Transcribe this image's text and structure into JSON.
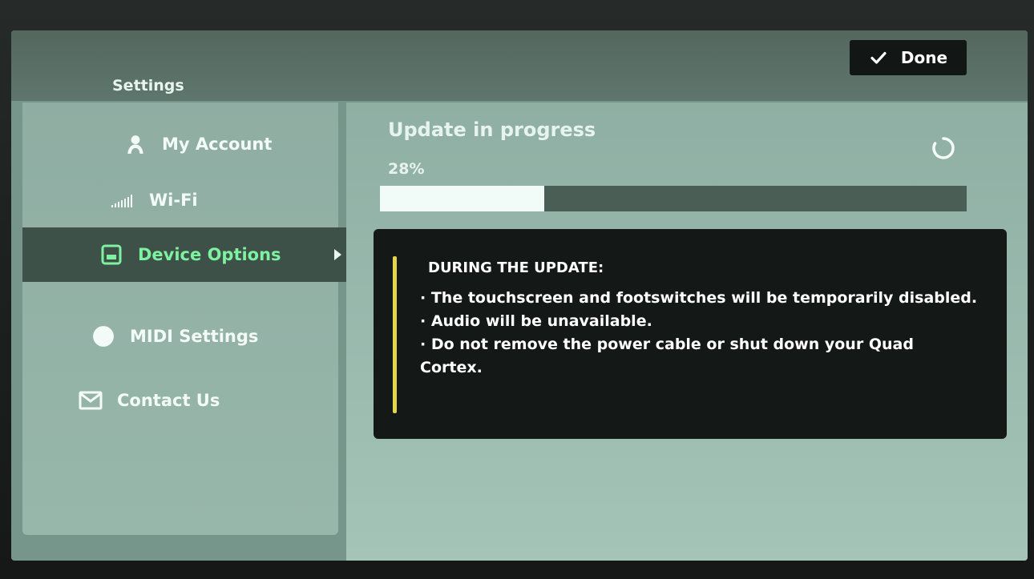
{
  "settings": {
    "title": "Settings",
    "done_label": "Done"
  },
  "sidebar": {
    "items": [
      {
        "label": "My Account",
        "icon": "account-icon"
      },
      {
        "label": "Wi-Fi",
        "icon": "wifi-icon"
      },
      {
        "label": "Device Options",
        "icon": "device-icon",
        "active": true
      },
      {
        "label": "MIDI Settings",
        "icon": "midi-icon"
      },
      {
        "label": "Contact Us",
        "icon": "mail-icon"
      }
    ]
  },
  "update": {
    "title": "Update in progress",
    "percent_label": "28%",
    "progress": 0.28,
    "notice_heading": "DURING THE UPDATE:",
    "notice_lines": [
      "· The touchscreen and footswitches will be temporarily disabled.",
      "· Audio will be unavailable.",
      "· Do not remove the power cable or shut down your Quad Cortex."
    ]
  },
  "colors": {
    "active_accent": "#7ef2a0",
    "notice_accent": "#e4d64a"
  }
}
